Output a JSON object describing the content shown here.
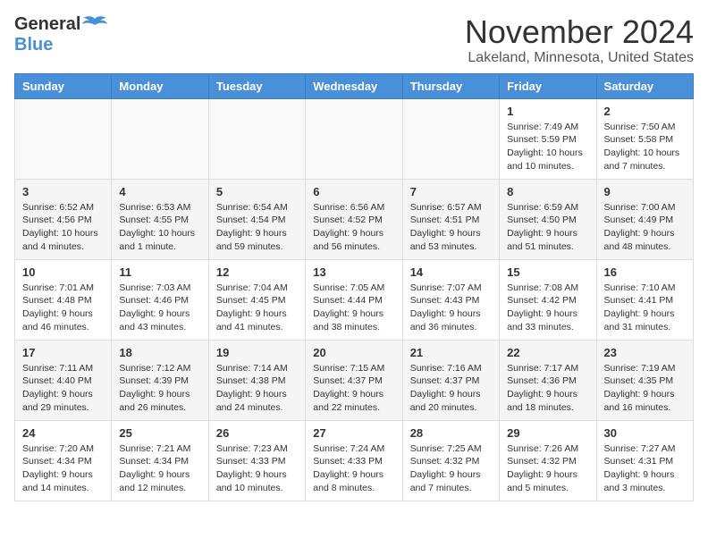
{
  "logo": {
    "general": "General",
    "blue": "Blue"
  },
  "header": {
    "month_year": "November 2024",
    "location": "Lakeland, Minnesota, United States"
  },
  "weekdays": [
    "Sunday",
    "Monday",
    "Tuesday",
    "Wednesday",
    "Thursday",
    "Friday",
    "Saturday"
  ],
  "weeks": [
    [
      {
        "day": "",
        "info": ""
      },
      {
        "day": "",
        "info": ""
      },
      {
        "day": "",
        "info": ""
      },
      {
        "day": "",
        "info": ""
      },
      {
        "day": "",
        "info": ""
      },
      {
        "day": "1",
        "info": "Sunrise: 7:49 AM\nSunset: 5:59 PM\nDaylight: 10 hours and 10 minutes."
      },
      {
        "day": "2",
        "info": "Sunrise: 7:50 AM\nSunset: 5:58 PM\nDaylight: 10 hours and 7 minutes."
      }
    ],
    [
      {
        "day": "3",
        "info": "Sunrise: 6:52 AM\nSunset: 4:56 PM\nDaylight: 10 hours and 4 minutes."
      },
      {
        "day": "4",
        "info": "Sunrise: 6:53 AM\nSunset: 4:55 PM\nDaylight: 10 hours and 1 minute."
      },
      {
        "day": "5",
        "info": "Sunrise: 6:54 AM\nSunset: 4:54 PM\nDaylight: 9 hours and 59 minutes."
      },
      {
        "day": "6",
        "info": "Sunrise: 6:56 AM\nSunset: 4:52 PM\nDaylight: 9 hours and 56 minutes."
      },
      {
        "day": "7",
        "info": "Sunrise: 6:57 AM\nSunset: 4:51 PM\nDaylight: 9 hours and 53 minutes."
      },
      {
        "day": "8",
        "info": "Sunrise: 6:59 AM\nSunset: 4:50 PM\nDaylight: 9 hours and 51 minutes."
      },
      {
        "day": "9",
        "info": "Sunrise: 7:00 AM\nSunset: 4:49 PM\nDaylight: 9 hours and 48 minutes."
      }
    ],
    [
      {
        "day": "10",
        "info": "Sunrise: 7:01 AM\nSunset: 4:48 PM\nDaylight: 9 hours and 46 minutes."
      },
      {
        "day": "11",
        "info": "Sunrise: 7:03 AM\nSunset: 4:46 PM\nDaylight: 9 hours and 43 minutes."
      },
      {
        "day": "12",
        "info": "Sunrise: 7:04 AM\nSunset: 4:45 PM\nDaylight: 9 hours and 41 minutes."
      },
      {
        "day": "13",
        "info": "Sunrise: 7:05 AM\nSunset: 4:44 PM\nDaylight: 9 hours and 38 minutes."
      },
      {
        "day": "14",
        "info": "Sunrise: 7:07 AM\nSunset: 4:43 PM\nDaylight: 9 hours and 36 minutes."
      },
      {
        "day": "15",
        "info": "Sunrise: 7:08 AM\nSunset: 4:42 PM\nDaylight: 9 hours and 33 minutes."
      },
      {
        "day": "16",
        "info": "Sunrise: 7:10 AM\nSunset: 4:41 PM\nDaylight: 9 hours and 31 minutes."
      }
    ],
    [
      {
        "day": "17",
        "info": "Sunrise: 7:11 AM\nSunset: 4:40 PM\nDaylight: 9 hours and 29 minutes."
      },
      {
        "day": "18",
        "info": "Sunrise: 7:12 AM\nSunset: 4:39 PM\nDaylight: 9 hours and 26 minutes."
      },
      {
        "day": "19",
        "info": "Sunrise: 7:14 AM\nSunset: 4:38 PM\nDaylight: 9 hours and 24 minutes."
      },
      {
        "day": "20",
        "info": "Sunrise: 7:15 AM\nSunset: 4:37 PM\nDaylight: 9 hours and 22 minutes."
      },
      {
        "day": "21",
        "info": "Sunrise: 7:16 AM\nSunset: 4:37 PM\nDaylight: 9 hours and 20 minutes."
      },
      {
        "day": "22",
        "info": "Sunrise: 7:17 AM\nSunset: 4:36 PM\nDaylight: 9 hours and 18 minutes."
      },
      {
        "day": "23",
        "info": "Sunrise: 7:19 AM\nSunset: 4:35 PM\nDaylight: 9 hours and 16 minutes."
      }
    ],
    [
      {
        "day": "24",
        "info": "Sunrise: 7:20 AM\nSunset: 4:34 PM\nDaylight: 9 hours and 14 minutes."
      },
      {
        "day": "25",
        "info": "Sunrise: 7:21 AM\nSunset: 4:34 PM\nDaylight: 9 hours and 12 minutes."
      },
      {
        "day": "26",
        "info": "Sunrise: 7:23 AM\nSunset: 4:33 PM\nDaylight: 9 hours and 10 minutes."
      },
      {
        "day": "27",
        "info": "Sunrise: 7:24 AM\nSunset: 4:33 PM\nDaylight: 9 hours and 8 minutes."
      },
      {
        "day": "28",
        "info": "Sunrise: 7:25 AM\nSunset: 4:32 PM\nDaylight: 9 hours and 7 minutes."
      },
      {
        "day": "29",
        "info": "Sunrise: 7:26 AM\nSunset: 4:32 PM\nDaylight: 9 hours and 5 minutes."
      },
      {
        "day": "30",
        "info": "Sunrise: 7:27 AM\nSunset: 4:31 PM\nDaylight: 9 hours and 3 minutes."
      }
    ]
  ]
}
